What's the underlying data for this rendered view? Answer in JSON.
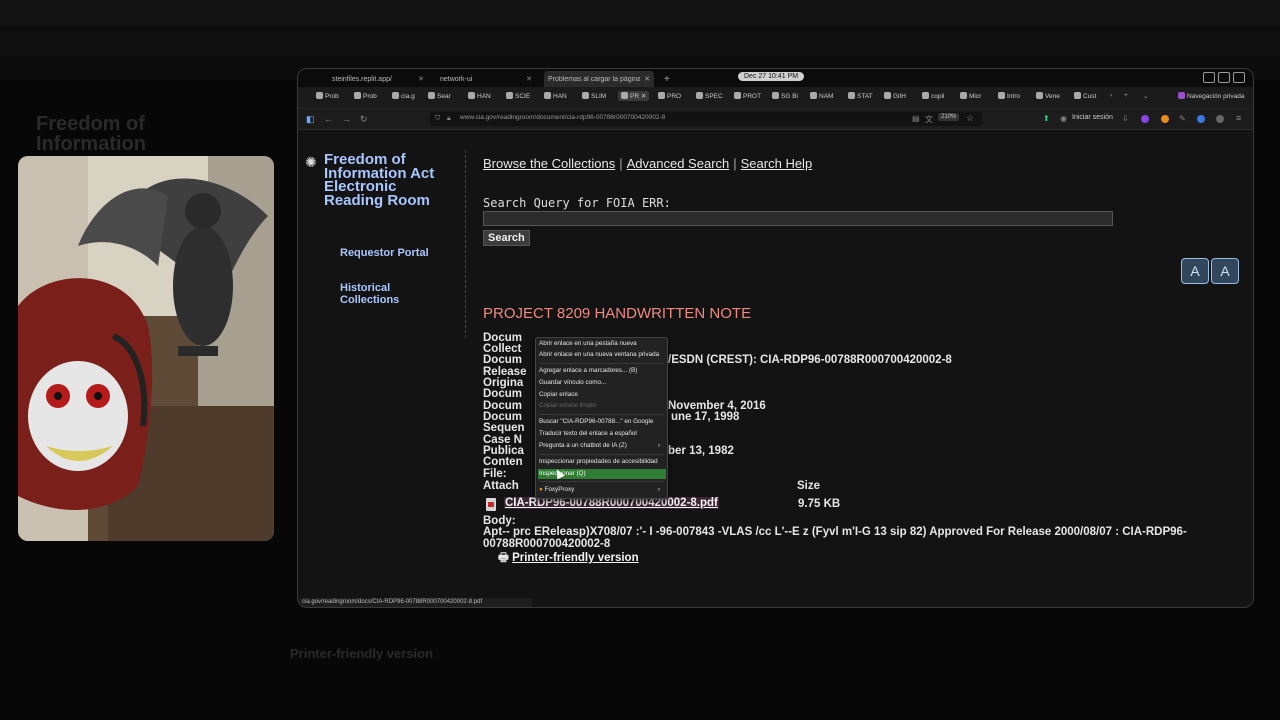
{
  "browser": {
    "clock": "Dec 27  10:41 PM",
    "tabs": [
      "steinfiles.replit.app/",
      "network-ui",
      "Problemas al cargar la página"
    ],
    "bookmarks": [
      "Prob",
      "Prob",
      "cia.g",
      "Sear",
      "HAN",
      "SCIE",
      "HAN",
      "SLIM",
      "PR",
      "PRO",
      "SPEC",
      "PROT",
      "SG Bi",
      "NAM",
      "STAT",
      "GitH",
      "copil",
      "Micr",
      "Intro",
      "Vene",
      "Cust"
    ],
    "private_label": "Navegación privada",
    "url": "www.cia.gov/readingroom/document/cia-rdp96-00788r000700420002-8",
    "zoom": "210%",
    "signin": "Iniciar sesión",
    "status_url": "cia.gov/readingroom/docs/CIA-RDP96-00788R000700420002-8.pdf"
  },
  "sidebar": {
    "title": "Freedom of Information Act Electronic Reading Room",
    "requestor": "Requestor Portal",
    "historical": "Historical Collections"
  },
  "nav": {
    "browse": "Browse the Collections",
    "advanced": "Advanced Search",
    "help": "Search Help",
    "sep": "|"
  },
  "search": {
    "label": "Search Query for FOIA ERR:",
    "value": "",
    "button": "Search"
  },
  "text_size": {
    "a1": "A",
    "a2": "A"
  },
  "document": {
    "title": "PROJECT 8209 HANDWRITTEN NOTE",
    "fields": [
      {
        "label": "Docum",
        "value": ""
      },
      {
        "label": "Collect",
        "value": ""
      },
      {
        "label": "Docum",
        "value": "/ESDN (CREST): CIA-RDP96-00788R000700420002-8"
      },
      {
        "label": "Release",
        "value": ""
      },
      {
        "label": "Origina",
        "value": ""
      },
      {
        "label": "Docum",
        "value": ""
      },
      {
        "label": "Docum",
        "value": "November 4, 2016"
      },
      {
        "label": "Docum",
        "value": "une 17, 1998"
      },
      {
        "label": "Sequen",
        "value": ""
      },
      {
        "label": "Case N",
        "value": ""
      },
      {
        "label": "Publica",
        "value": "ber 13, 1982"
      },
      {
        "label": "Conten",
        "value": ""
      },
      {
        "label": "File:",
        "value": ""
      }
    ],
    "attach_label": "Attach",
    "size_label": "Size",
    "file_name": "CIA-RDP96-00788R000700420002-8.pdf",
    "file_size": "9.75 KB",
    "body_label": "Body:",
    "body_text": "Apt-- prc EReleasp)X708/07 :'- I -96-007843 -VLAS /cc L'--E z (Fyvl m'I-G 13 sip 82) Approved For Release 2000/08/07 : CIA-RDP96-00788R000700420002-8",
    "printer_label": "Printer-friendly version"
  },
  "context_menu": [
    {
      "label": "Abrir enlace en una pestaña nueva",
      "state": "normal"
    },
    {
      "label": "Abrir enlace en una nueva ventana privada",
      "state": "normal"
    },
    {
      "label": "Agregar enlace a marcadores... (B)",
      "state": "normal"
    },
    {
      "label": "Guardar vínculo como...",
      "state": "normal"
    },
    {
      "label": "Copiar enlace",
      "state": "normal"
    },
    {
      "label": "Copiar enlace limpio",
      "state": "disabled"
    },
    {
      "label": "Buscar \"CIA-RDP96-00788...\" en Google",
      "state": "normal"
    },
    {
      "label": "Traducir texto del enlace a español",
      "state": "normal"
    },
    {
      "label": "Pregunta a un chatbot de IA (Z)",
      "state": "normal"
    },
    {
      "label": "Inspeccionar propiedades de accesibilidad",
      "state": "normal"
    },
    {
      "label": "Inspeccionar (Q)",
      "state": "highlighted"
    },
    {
      "label": "FoxyProxy",
      "state": "normal"
    }
  ],
  "background": {
    "heading": "Freedom of Information",
    "printer": "Printer-friendly version"
  }
}
